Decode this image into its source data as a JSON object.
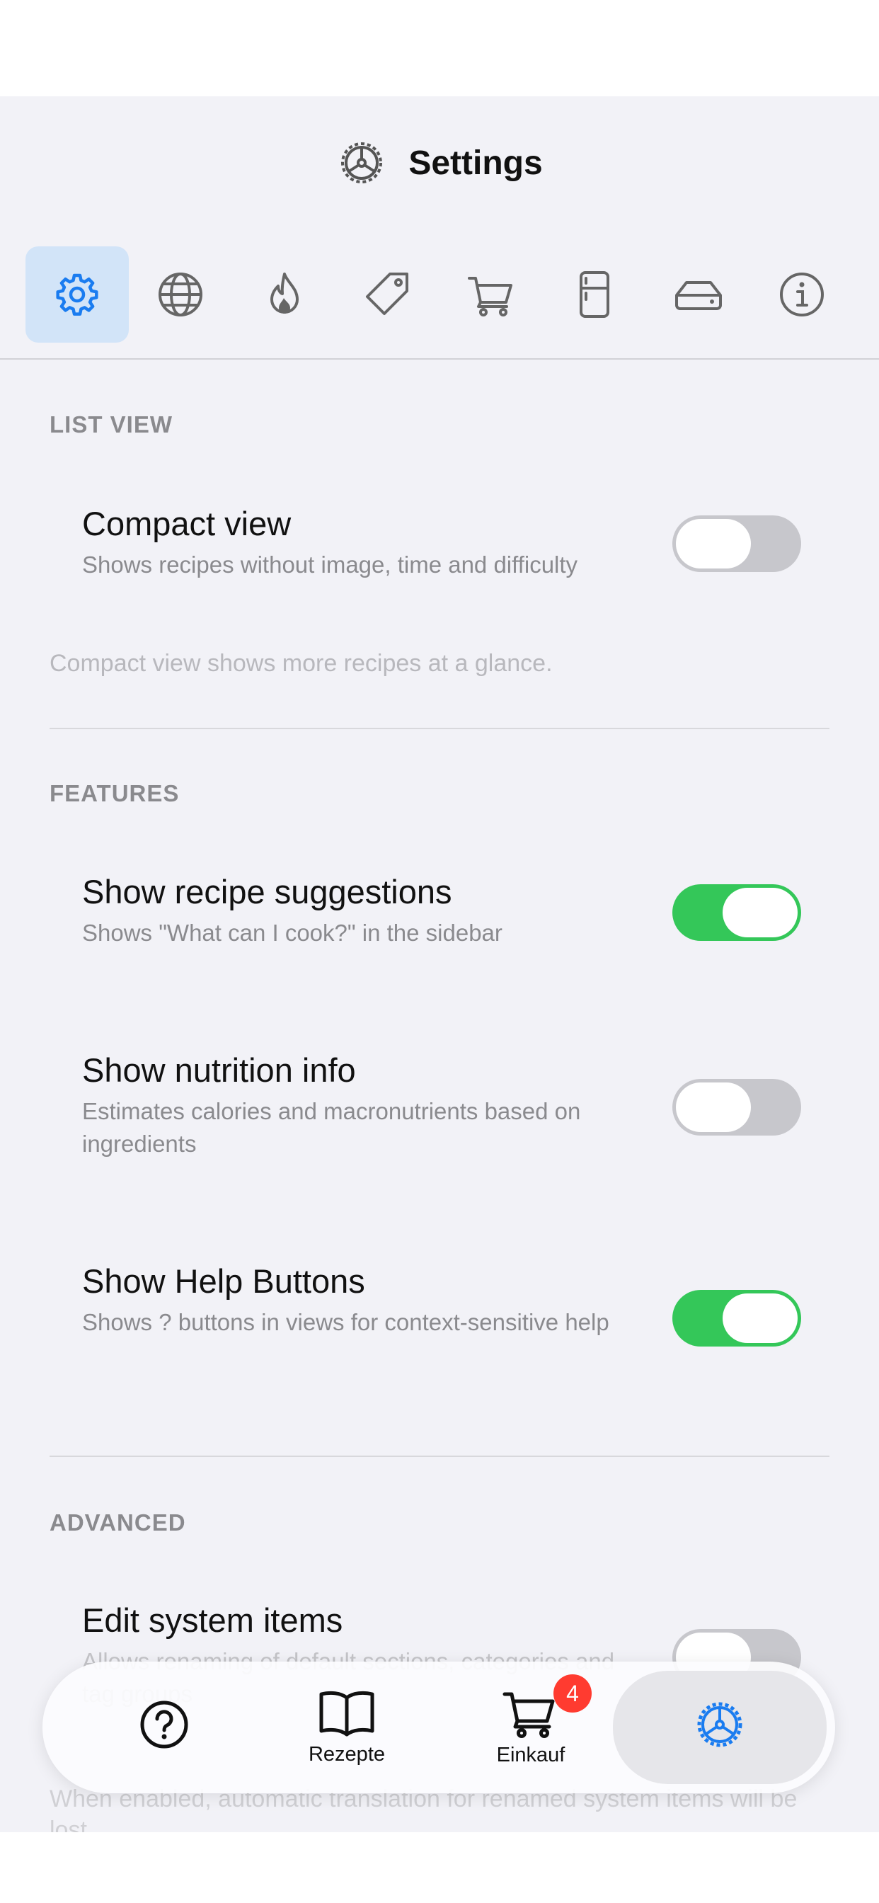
{
  "header": {
    "title": "Settings"
  },
  "icon_tabs": [
    "gear-icon",
    "globe-icon",
    "flame-icon",
    "tag-icon",
    "cart-icon",
    "fridge-icon",
    "drive-icon",
    "info-icon"
  ],
  "sections": {
    "list_view": {
      "header": "LIST VIEW",
      "compact": {
        "title": "Compact view",
        "subtitle": "Shows recipes without image, time and difficulty",
        "on": false
      },
      "footer": "Compact view shows more recipes at a glance."
    },
    "features": {
      "header": "FEATURES",
      "suggestions": {
        "title": "Show recipe suggestions",
        "subtitle": "Shows \"What can I cook?\" in the sidebar",
        "on": true
      },
      "nutrition": {
        "title": "Show nutrition info",
        "subtitle": "Estimates calories and macronutrients based on ingredients",
        "on": false
      },
      "help": {
        "title": "Show Help Buttons",
        "subtitle": "Shows ? buttons in views for context-sensitive help",
        "on": true
      }
    },
    "advanced": {
      "header": "ADVANCED",
      "edit_system": {
        "title": "Edit system items",
        "subtitle_partial": "Allows renaming of default sections, categories and tag groups",
        "on": false
      },
      "footer_partial": "When enabled, automatic translation for renamed system items will be lost."
    }
  },
  "tabbar": {
    "help_label": "",
    "recipes_label": "Rezepte",
    "shopping_label": "Einkauf",
    "shopping_badge": "4",
    "settings_label": ""
  },
  "colors": {
    "accent": "#1a7cf0",
    "toggle_on": "#34c759",
    "toggle_off": "#c7c7cc",
    "badge": "#ff3b30"
  }
}
